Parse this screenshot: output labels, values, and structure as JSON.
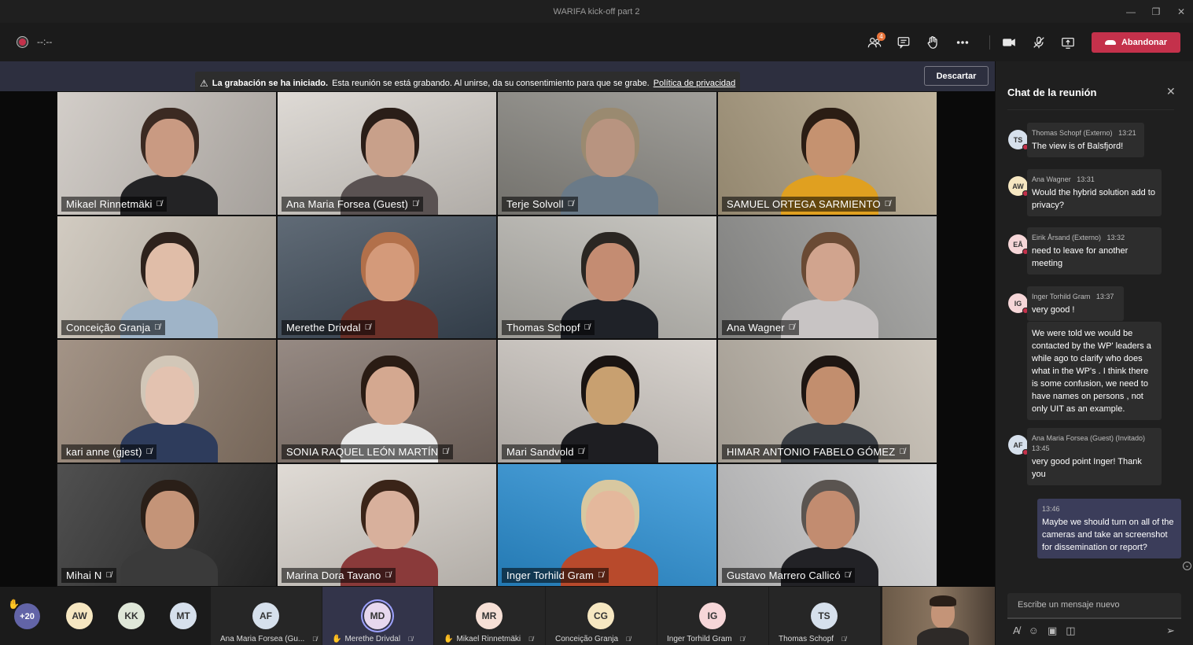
{
  "window": {
    "title": "WARIFA kick-off part 2",
    "minimize": "—",
    "maximize": "❐",
    "close": "✕"
  },
  "toolbar": {
    "timer": "--:--",
    "participants_badge": "4",
    "leave_label": "Abandonar"
  },
  "banner": {
    "bold": "La grabación se ha iniciado.",
    "text": "Esta reunión se está grabando. Al unirse, da su consentimiento para que se grabe.",
    "link": "Política de privacidad",
    "dismiss": "Descartar"
  },
  "tiles": [
    {
      "name": "Mikael Rinnetmäki",
      "bg": "#c9c3bd",
      "skin": "#c99a82",
      "hair": "#3b2a22",
      "shirt": "#232325"
    },
    {
      "name": "Ana Maria Forsea (Guest)",
      "bg": "#d7d2cc",
      "skin": "#c8a08a",
      "hair": "#2a1e18",
      "shirt": "#5a5252"
    },
    {
      "name": "Terje Solvoll",
      "bg": "#8c8a84",
      "skin": "#b89480",
      "hair": "#9a8a70",
      "shirt": "#6a7a88"
    },
    {
      "name": "SAMUEL ORTEGA SARMIENTO",
      "bg": "#b3a487",
      "skin": "#c59270",
      "hair": "#2b1d14",
      "shirt": "#e0a020"
    },
    {
      "name": "Conceição Granja",
      "bg": "#c8c0b4",
      "skin": "#e0bda8",
      "hair": "#2e221c",
      "shirt": "#9fb4c8"
    },
    {
      "name": "Merethe Drivdal",
      "bg": "#3d4a58",
      "skin": "#d49a7a",
      "hair": "#b2704a",
      "shirt": "#6a3028"
    },
    {
      "name": "Thomas Schopf",
      "bg": "#bcbab4",
      "skin": "#c48c72",
      "hair": "#2a2622",
      "shirt": "#1f2228"
    },
    {
      "name": "Ana Wagner",
      "bg": "#9a9a98",
      "skin": "#d1a48e",
      "hair": "#6a4a34",
      "shirt": "#c8c4c4"
    },
    {
      "name": "kari anne (gjest)",
      "bg": "#8f7c6c",
      "skin": "#e3c2b0",
      "hair": "#d2c7b8",
      "shirt": "#2e3c5c"
    },
    {
      "name": "SONIA RAQUEL LEÓN MARTÍN",
      "bg": "#7f7068",
      "skin": "#d4a890",
      "hair": "#2a1c14",
      "shirt": "#e8e8e8"
    },
    {
      "name": "Mari Sandvold",
      "bg": "#d0cac4",
      "skin": "#c8a070",
      "hair": "#1a1412",
      "shirt": "#1e1e22"
    },
    {
      "name": "HIMAR ANTONIO FABELO GÓMEZ",
      "bg": "#c4bcb0",
      "skin": "#c28e6e",
      "hair": "#1e1612",
      "shirt": "#3a3e44"
    },
    {
      "name": "Mihai N",
      "bg": "#2a2a2a",
      "skin": "#c49478",
      "hair": "#2a1f18",
      "shirt": "#3a3a3a"
    },
    {
      "name": "Marina Dora Tavano",
      "bg": "#d9d3cc",
      "skin": "#d8b09c",
      "hair": "#3a2418",
      "shirt": "#8a3a3a"
    },
    {
      "name": "Inger Torhild Gram",
      "bg": "#2b93d9",
      "skin": "#e4b89c",
      "hair": "#d8c8a0",
      "shirt": "#b84a2c"
    },
    {
      "name": "Gustavo Marrero Callicó",
      "bg": "#cfcfd0",
      "skin": "#c28c70",
      "hair": "#5a5450",
      "shirt": "#222226"
    }
  ],
  "roster": {
    "more": "+20",
    "avatars": [
      {
        "initials": "AW",
        "color": "#f6e7c1"
      },
      {
        "initials": "KK",
        "color": "#dfe7d8"
      },
      {
        "initials": "MT",
        "color": "#d6e0ec"
      }
    ],
    "slots": [
      {
        "initials": "AF",
        "color": "#d6e0ec",
        "label": "Ana Maria Forsea (Gu...",
        "hand": false
      },
      {
        "initials": "MD",
        "color": "#e7d8ee",
        "label": "Merethe Drivdal",
        "hand": true
      },
      {
        "initials": "MR",
        "color": "#f6e0d6",
        "label": "Mikael Rinnetmäki",
        "hand": true
      },
      {
        "initials": "CG",
        "color": "#f6e7c1",
        "label": "Conceição Granja",
        "hand": false
      },
      {
        "initials": "IG",
        "color": "#f6d6d8",
        "label": "Inger Torhild Gram",
        "hand": false
      },
      {
        "initials": "TS",
        "color": "#d6e0ec",
        "label": "Thomas Schopf",
        "hand": false
      }
    ]
  },
  "chat": {
    "title": "Chat de la reunión",
    "messages": [
      {
        "initials": "TS",
        "avcolor": "#d6e0ec",
        "author": "Thomas Schopf (Externo)",
        "time": "13:21",
        "text": "The view is of Balsfjord!"
      },
      {
        "initials": "AW",
        "avcolor": "#f6e7c1",
        "author": "Ana Wagner",
        "time": "13:31",
        "text": "Would the hybrid solution add to privacy?"
      },
      {
        "initials": "EÅ",
        "avcolor": "#f6d6d8",
        "author": "Eirik Årsand (Externo)",
        "time": "13:32",
        "text": "need to leave for another meeting"
      },
      {
        "initials": "IG",
        "avcolor": "#f6d6d8",
        "author": "Inger Torhild Gram",
        "time": "13:37",
        "text": "very good !"
      },
      {
        "initials": "",
        "avcolor": "",
        "author": "",
        "time": "",
        "text": "We were told we would be contacted by the WP' leaders a while ago to clarify who does what in the WP's . I think there is some confusion, we need to have names on persons , not only UIT as an example."
      },
      {
        "initials": "AF",
        "avcolor": "#d6e0ec",
        "author": "Ana Maria Forsea (Guest) (Invitado)",
        "time": "13:45",
        "text": "very good point Inger! Thank you"
      },
      {
        "initials": "",
        "avcolor": "",
        "author": "",
        "time": "13:46",
        "text": "Maybe we should turn on all of the cameras and take an screenshot for dissemination or report?"
      }
    ],
    "compose_placeholder": "Escribe un mensaje nuevo"
  }
}
